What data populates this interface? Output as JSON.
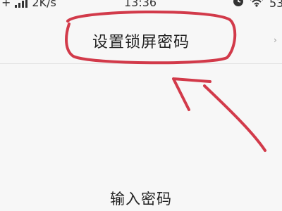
{
  "status_bar": {
    "network_speed": "2K/s",
    "time": "13:36",
    "battery": "53"
  },
  "nav": {
    "title": "设置锁屏密码"
  },
  "content": {
    "prompt": "输入密码"
  },
  "colors": {
    "annotation": "#d23a4a",
    "background": "#f7f7f7"
  }
}
